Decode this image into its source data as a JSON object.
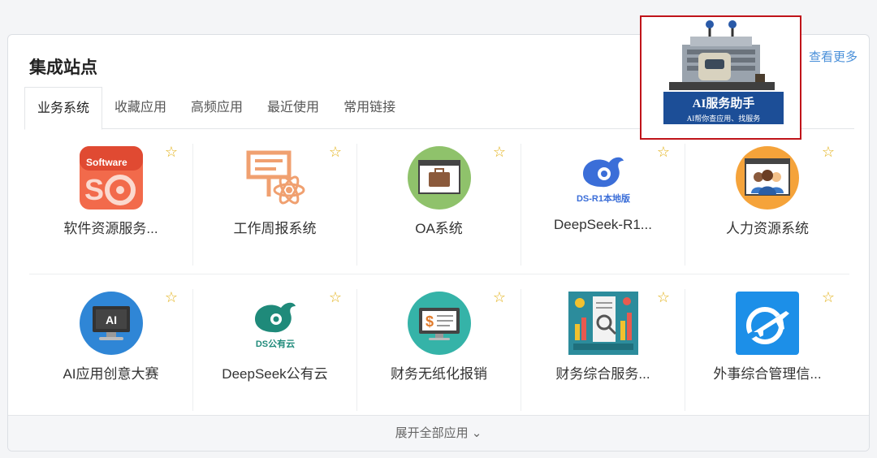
{
  "header": {
    "title": "集成站点",
    "more_label": "查看更多"
  },
  "tabs": [
    {
      "label": "业务系统",
      "active": true
    },
    {
      "label": "收藏应用"
    },
    {
      "label": "高频应用"
    },
    {
      "label": "最近使用"
    },
    {
      "label": "常用链接"
    }
  ],
  "apps": [
    {
      "name": "软件资源服务...",
      "icon": "software-icon",
      "icon_text": "Software"
    },
    {
      "name": "工作周报系统",
      "icon": "weekly-report-icon"
    },
    {
      "name": "OA系统",
      "icon": "briefcase-icon"
    },
    {
      "name": "DeepSeek-R1...",
      "icon": "deepseek-local-icon",
      "icon_text": "DS-R1本地版"
    },
    {
      "name": "人力资源系统",
      "icon": "hr-people-icon"
    },
    {
      "name": "AI应用创意大赛",
      "icon": "ai-monitor-icon",
      "icon_text": "AI"
    },
    {
      "name": "DeepSeek公有云",
      "icon": "deepseek-cloud-icon",
      "icon_text": "DS公有云"
    },
    {
      "name": "财务无纸化报销",
      "icon": "finance-screen-icon"
    },
    {
      "name": "财务综合服务...",
      "icon": "finance-report-icon"
    },
    {
      "name": "外事综合管理信...",
      "icon": "airplane-globe-icon"
    }
  ],
  "footer": {
    "expand_label": "展开全部应用"
  },
  "promo": {
    "title": "AI服务助手",
    "subtitle": "AI帮你查应用、找服务"
  },
  "colors": {
    "accent": "#4a90d9",
    "highlight_border": "#c0141a",
    "star": "#e3b21b"
  }
}
